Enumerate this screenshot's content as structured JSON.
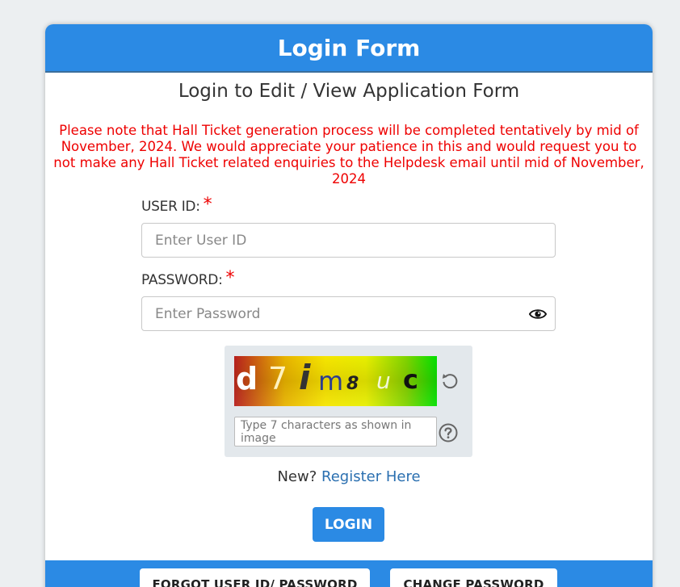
{
  "header": {
    "title": "Login Form"
  },
  "subtitle": "Login to Edit / View Application Form",
  "notice": "Please note that Hall Ticket generation process will be completed tentatively by mid of November, 2024. We would appreciate your patience in this and would request you to not make any Hall Ticket related enquiries to the Helpdesk email until mid of November, 2024",
  "form": {
    "user_id_label": "USER ID:",
    "user_id_placeholder": "Enter User ID",
    "password_label": "PASSWORD:",
    "password_placeholder": "Enter Password",
    "required_mark": "*"
  },
  "captcha": {
    "chars": [
      "d",
      "7",
      "i",
      "m",
      "8",
      "u",
      "c"
    ],
    "input_placeholder": "Type 7 characters as shown in image",
    "icons": {
      "refresh": "refresh-icon",
      "help": "help-icon"
    }
  },
  "register": {
    "prefix": "New?",
    "link": "Register Here"
  },
  "buttons": {
    "login": "LOGIN",
    "forgot": "FORGOT USER ID/ PASSWORD",
    "change": "CHANGE PASSWORD"
  },
  "colors": {
    "primary": "#2b8ae4",
    "notice": "#ee0000",
    "link": "#2a6fb0"
  }
}
